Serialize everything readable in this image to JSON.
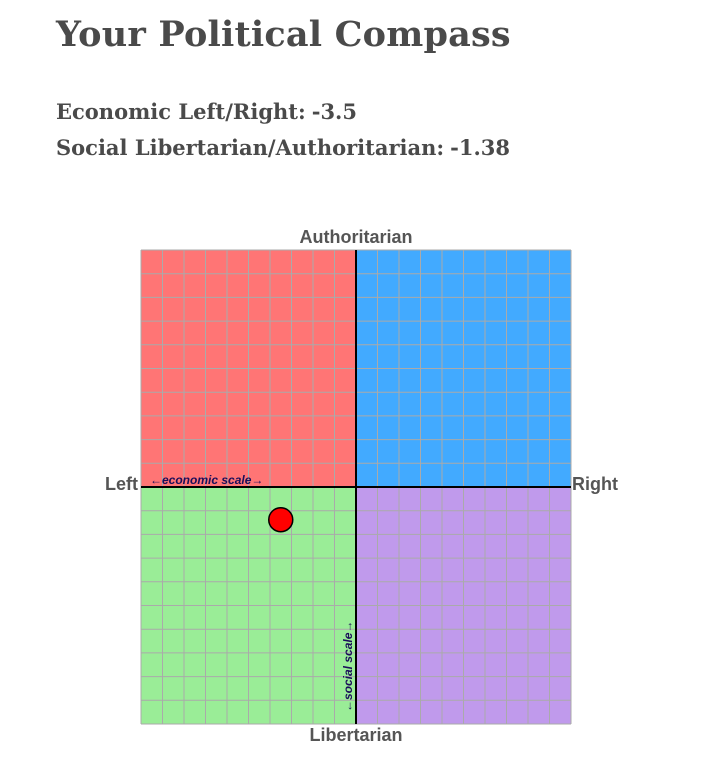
{
  "header": {
    "title": "Your Political Compass"
  },
  "scores": {
    "economic_label": "Economic Left/Right:",
    "economic_value": "-3.5",
    "social_label": "Social Libertarian/Authoritarian:",
    "social_value": "-1.38"
  },
  "compass": {
    "axis_top": "Authoritarian",
    "axis_bottom": "Libertarian",
    "axis_left": "Left",
    "axis_right": "Right",
    "economic_scale_label": "←economic scale→",
    "social_scale_label": "←social scale→",
    "economic_range": [
      -10,
      10
    ],
    "social_range": [
      -10,
      10
    ],
    "grid_divisions": 20,
    "quadrant_colors": {
      "authoritarian_left": "#ff7575",
      "authoritarian_right": "#42aaff",
      "libertarian_left": "#9aed97",
      "libertarian_right": "#c09aec"
    },
    "grid_color": "#aaaaaa",
    "axis_color": "#000000",
    "marker_color": "#ff0000",
    "result": {
      "economic": -3.5,
      "social": -1.38
    }
  }
}
